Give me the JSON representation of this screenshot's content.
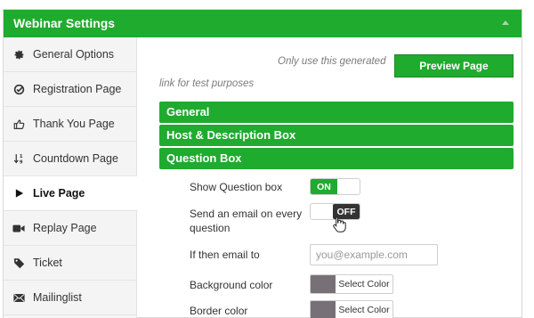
{
  "window": {
    "title": "Webinar Settings"
  },
  "sidebar": {
    "items": [
      {
        "label": "General Options",
        "icon": "gear-icon"
      },
      {
        "label": "Registration Page",
        "icon": "check-circle-icon"
      },
      {
        "label": "Thank You Page",
        "icon": "thumbs-up-icon"
      },
      {
        "label": "Countdown Page",
        "icon": "sort-numeric-icon"
      },
      {
        "label": "Live Page",
        "icon": "play-icon",
        "active": true
      },
      {
        "label": "Replay Page",
        "icon": "video-camera-icon"
      },
      {
        "label": "Ticket",
        "icon": "tag-icon"
      },
      {
        "label": "Mailinglist",
        "icon": "envelope-icon"
      }
    ]
  },
  "main": {
    "note_line1": "Only use this generated",
    "note_line2": "link for test purposes",
    "preview_button": "Preview Page",
    "sections": [
      "General",
      "Host & Description Box",
      "Question Box"
    ],
    "question_box": {
      "show_question_label": "Show Question box",
      "show_question_state": "ON",
      "send_email_label_line1": "Send an email on every",
      "send_email_label_line2": "question",
      "send_email_state": "OFF",
      "email_to_label": "If then email to",
      "email_placeholder": "you@example.com",
      "bg_color_label": "Background color",
      "border_color_label": "Border color",
      "select_color_label": "Select Color",
      "swatch_color": "#777177"
    }
  },
  "colors": {
    "accent": "#1fab2e",
    "toggle_off": "#333333"
  }
}
